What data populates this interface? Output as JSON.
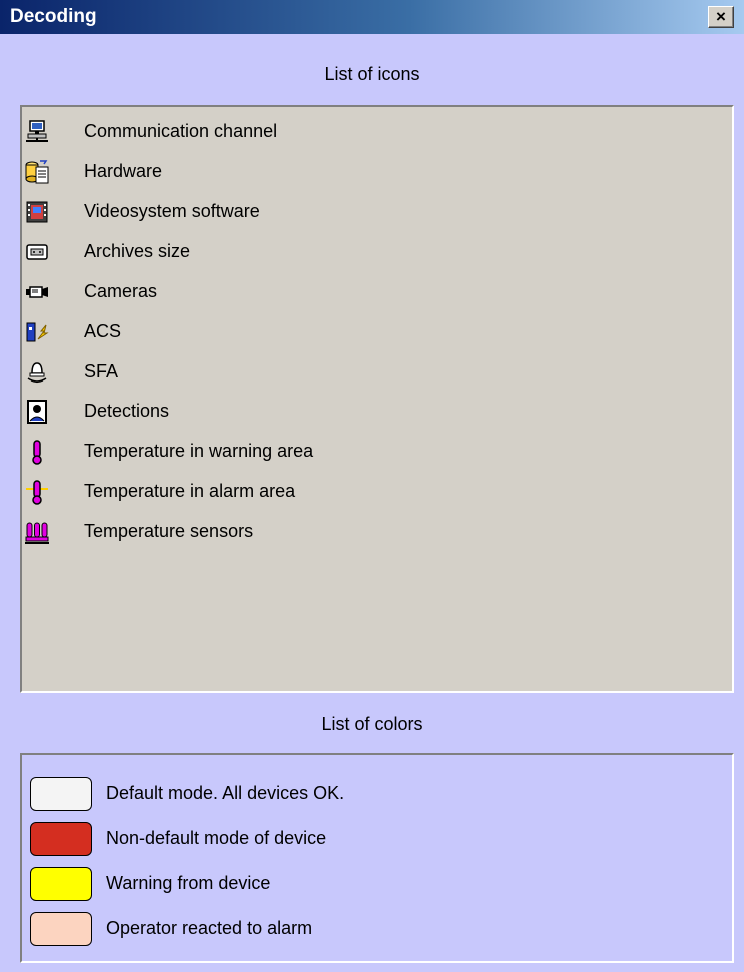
{
  "window": {
    "title": "Decoding",
    "close_label": "×"
  },
  "icons_section": {
    "heading": "List of icons",
    "items": [
      {
        "label": "Communication channel",
        "icon": "computer-icon"
      },
      {
        "label": "Hardware",
        "icon": "hardware-icon"
      },
      {
        "label": "Videosystem software",
        "icon": "film-icon"
      },
      {
        "label": "Archives size",
        "icon": "archive-icon"
      },
      {
        "label": "Cameras",
        "icon": "camera-icon"
      },
      {
        "label": "ACS",
        "icon": "lightning-door-icon"
      },
      {
        "label": "SFA",
        "icon": "siren-icon"
      },
      {
        "label": "Detections",
        "icon": "detector-icon"
      },
      {
        "label": "Temperature in warning area",
        "icon": "thermometer-warning-icon"
      },
      {
        "label": "Temperature in alarm area",
        "icon": "thermometer-alarm-icon"
      },
      {
        "label": "Temperature sensors",
        "icon": "temperature-sensors-icon"
      }
    ]
  },
  "colors_section": {
    "heading": "List of colors",
    "items": [
      {
        "label": "Default mode. All devices OK.",
        "color": "#f4f4f4"
      },
      {
        "label": "Non-default mode of device",
        "color": "#d42e20"
      },
      {
        "label": "Warning from device",
        "color": "#ffff00"
      },
      {
        "label": "Operator reacted to alarm",
        "color": "#fcd4c0"
      }
    ]
  }
}
